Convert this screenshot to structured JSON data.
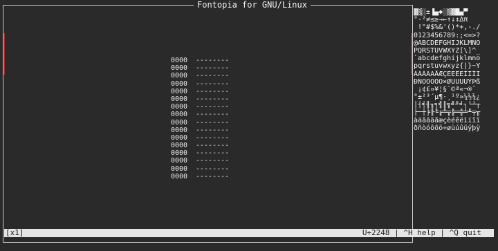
{
  "app": {
    "title": "Fontopia for GNU/Linux"
  },
  "bitmap": {
    "addr": "0000",
    "row_pattern": "--------",
    "rows": 16
  },
  "charset": {
    "rows": [
      "▓▒░±▐▄◆░▒▓█▄▀",
      "°·²≠≤≥→←↑↓↕∆π",
      " !\"#$%&'()*+,-./",
      "0123456789:;<=>?",
      "@ABCDEFGHIJKLMNO",
      "PQRSTUVWXYZ[\\]^_",
      "`abcdefghijklmno",
      "pqrstuvwxyz{|}~Ÿ",
      "ÀÁÂÃÄÅÆÇÈÉÊËÌÍÎÏ",
      "ÐÑÒÓÔÕÖ×ØÙÚÛÜÝÞß",
      " ¡¢£¤¥¦§¨©ª«¬­®¯",
      "°±²³´µ¶·¸¹º»¼½¾¿",
      "│┤╡╢╖╕╣║╗╝╜╛┐└┴┬",
      "├─┼╞╟╚╔╩╦╠═╬╧╨╤╥",
      "àáâãäåæçèéêëìíîï",
      "ðñòóôõö÷øùúûüýþÿ"
    ]
  },
  "status": {
    "mode": "[x1]",
    "right": "U+2248 | ^H help | ^Q quit"
  }
}
